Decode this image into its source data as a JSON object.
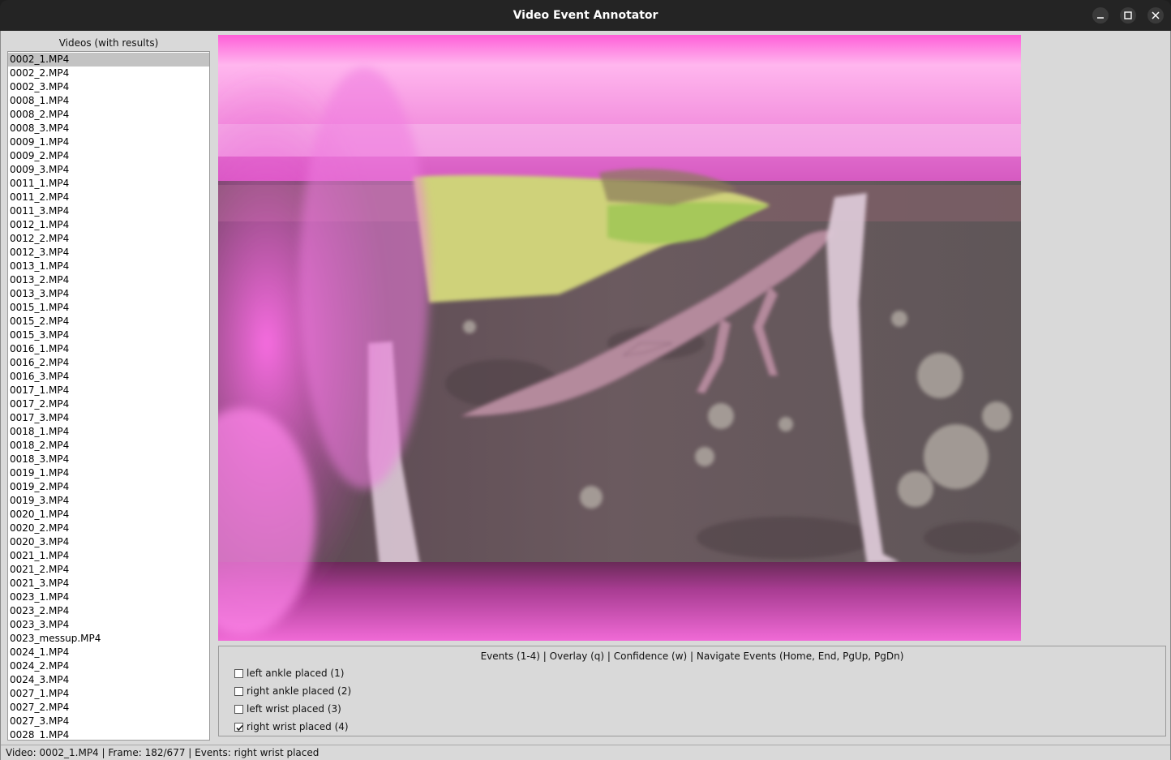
{
  "window": {
    "title": "Video Event Annotator",
    "controls": [
      "minimize-icon",
      "maximize-icon",
      "close-icon"
    ]
  },
  "video_list": {
    "header": "Videos (with results)",
    "selected_index": 0,
    "items": [
      "0002_1.MP4",
      "0002_2.MP4",
      "0002_3.MP4",
      "0008_1.MP4",
      "0008_2.MP4",
      "0008_3.MP4",
      "0009_1.MP4",
      "0009_2.MP4",
      "0009_3.MP4",
      "0011_1.MP4",
      "0011_2.MP4",
      "0011_3.MP4",
      "0012_1.MP4",
      "0012_2.MP4",
      "0012_3.MP4",
      "0013_1.MP4",
      "0013_2.MP4",
      "0013_3.MP4",
      "0015_1.MP4",
      "0015_2.MP4",
      "0015_3.MP4",
      "0016_1.MP4",
      "0016_2.MP4",
      "0016_3.MP4",
      "0017_1.MP4",
      "0017_2.MP4",
      "0017_3.MP4",
      "0018_1.MP4",
      "0018_2.MP4",
      "0018_3.MP4",
      "0019_1.MP4",
      "0019_2.MP4",
      "0019_3.MP4",
      "0020_1.MP4",
      "0020_2.MP4",
      "0020_3.MP4",
      "0021_1.MP4",
      "0021_2.MP4",
      "0021_3.MP4",
      "0023_1.MP4",
      "0023_2.MP4",
      "0023_3.MP4",
      "0023_messup.MP4",
      "0024_1.MP4",
      "0024_2.MP4",
      "0024_3.MP4",
      "0027_1.MP4",
      "0027_2.MP4",
      "0027_3.MP4",
      "0028_1.MP4"
    ]
  },
  "events_panel": {
    "hint": "Events (1-4) | Overlay (q) | Confidence (w) | Navigate Events (Home, End, PgUp, PgDn)",
    "events": [
      {
        "label": "left ankle placed (1)",
        "checked": false
      },
      {
        "label": "right ankle placed (2)",
        "checked": false
      },
      {
        "label": "left wrist placed (3)",
        "checked": false
      },
      {
        "label": "right wrist placed (4)",
        "checked": true
      }
    ]
  },
  "status_bar": {
    "text": "Video: 0002_1.MP4 | Frame: 182/677 | Events: right wrist placed"
  },
  "colors": {
    "titlebar": "#242424",
    "window_bg": "#d9d9d9",
    "list_selected": "#c3c3c3",
    "video_magenta": "#e070d0"
  }
}
